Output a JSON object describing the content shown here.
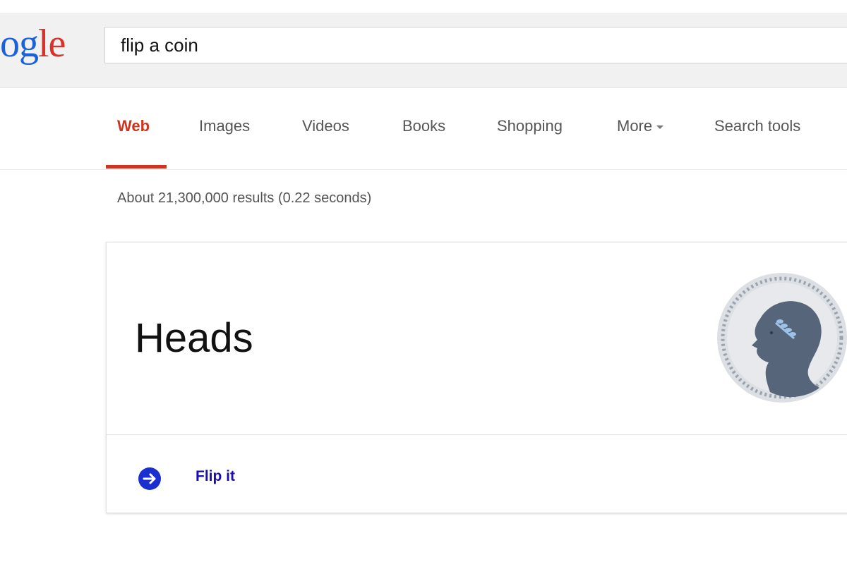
{
  "header": {
    "logo_parts": [
      "o",
      "g",
      "le"
    ],
    "search": {
      "value": "flip a coin",
      "placeholder": ""
    }
  },
  "tabs": [
    {
      "label": "Web",
      "active": true
    },
    {
      "label": "Images",
      "active": false
    },
    {
      "label": "Videos",
      "active": false
    },
    {
      "label": "Books",
      "active": false
    },
    {
      "label": "Shopping",
      "active": false
    },
    {
      "label": "More",
      "active": false
    },
    {
      "label": "Search tools",
      "active": false
    }
  ],
  "results": {
    "stats": "About 21,300,000 results (0.22 seconds)"
  },
  "coin_card": {
    "result": "Heads",
    "action_label": "Flip it",
    "coin_icon": "coin-heads-icon",
    "action_icon": "arrow-right-circle-icon"
  },
  "colors": {
    "accent_red": "#d0341f",
    "link_blue": "#1a0dab",
    "icon_blue": "#1a2fd0",
    "coin_silver": "#dcdfe3",
    "coin_slate": "#566579"
  }
}
